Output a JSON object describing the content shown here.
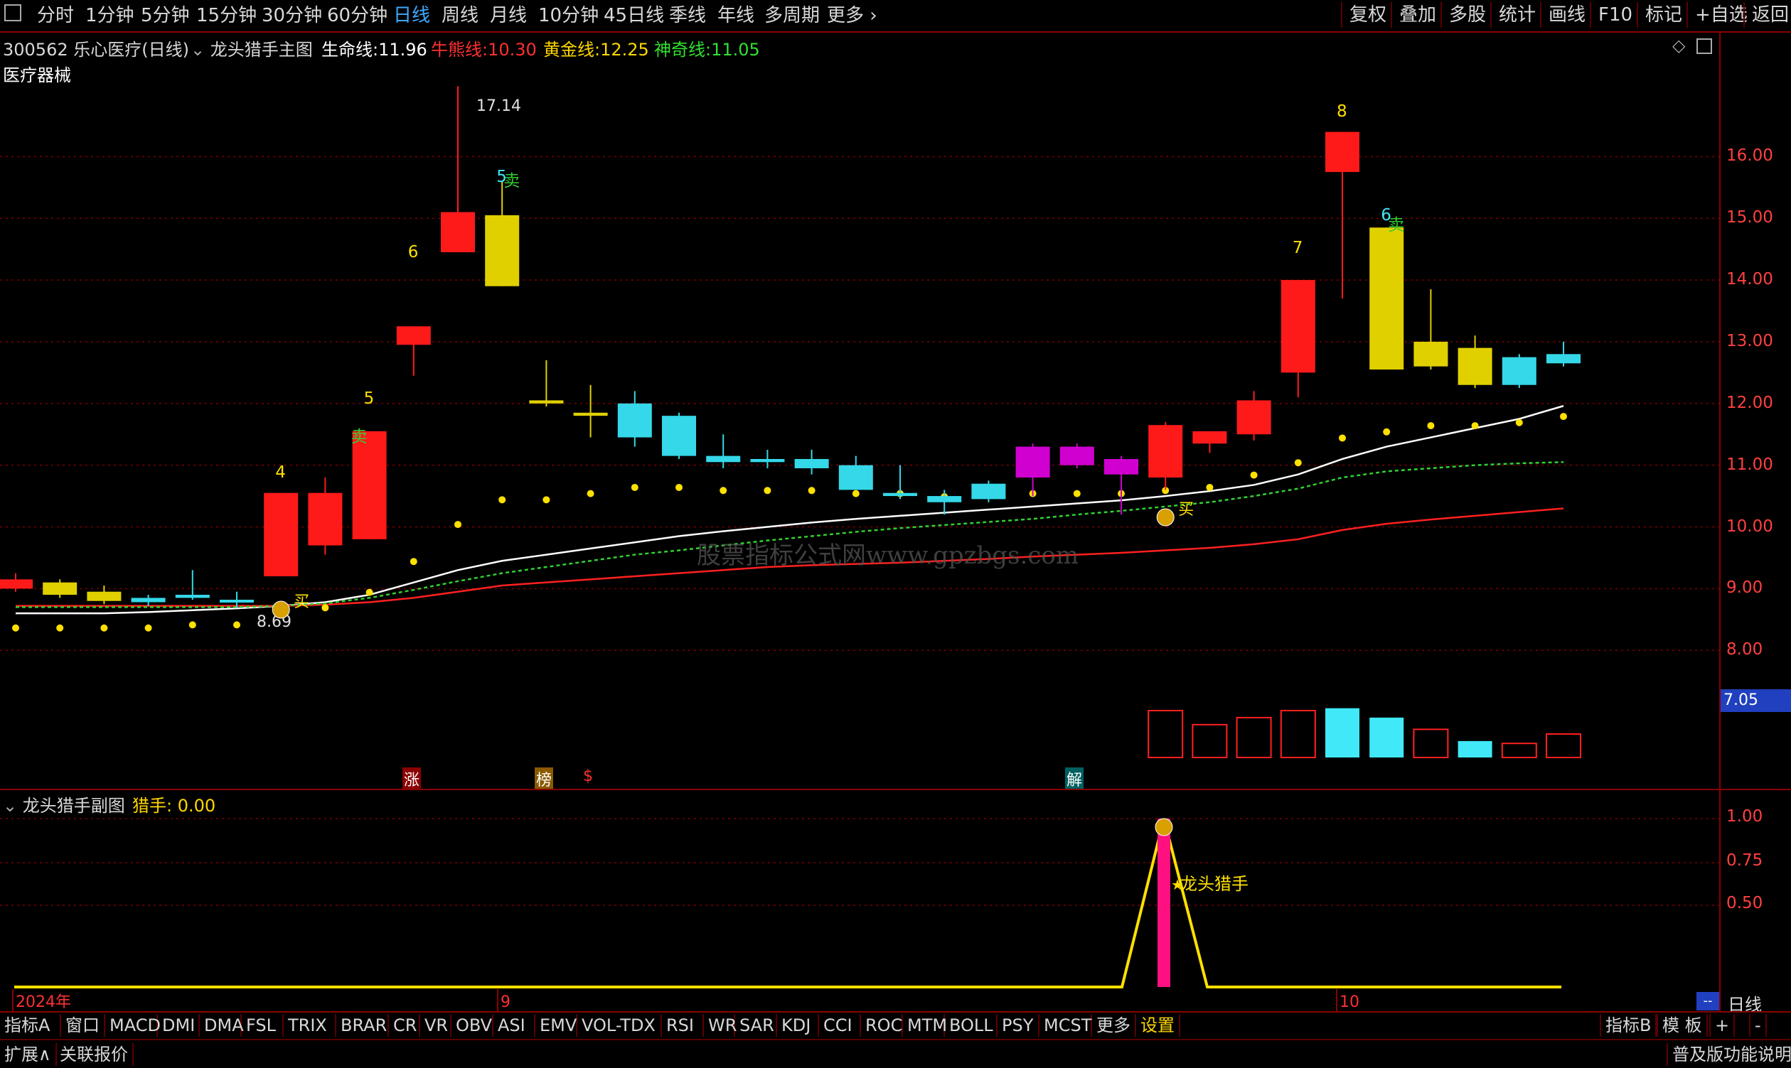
{
  "toolbar": {
    "left_icon": "window-icon",
    "periods": [
      "分时",
      "1分钟",
      "5分钟",
      "15分钟",
      "30分钟",
      "60分钟",
      "日线",
      "周线",
      "月线",
      "10分钟",
      "45日线",
      "季线",
      "年线",
      "多周期",
      "更多"
    ],
    "active_period": "日线",
    "right": [
      "复权",
      "叠加",
      "多股",
      "统计",
      "画线",
      "F10",
      "标记",
      "+自选",
      "返回"
    ]
  },
  "header": {
    "stock": "300562 乐心医疗(日线)",
    "indicator": "龙头猎手主图",
    "line1_label": "生命线:",
    "line1_value": "11.96",
    "line2_label": "牛熊线:",
    "line2_value": "10.30",
    "line3_label": "黄金线:",
    "line3_value": "12.25",
    "line4_label": "神奇线:",
    "line4_value": "11.05",
    "sector": "医疗器械"
  },
  "watermark": "股票指标公式网www.gpzbgs.com",
  "main_chart": {
    "y_ticks": [
      "16.00",
      "15.00",
      "14.00",
      "13.00",
      "12.00",
      "11.00",
      "10.00",
      "9.00",
      "8.00"
    ],
    "current_price": "7.05",
    "high_label": "17.14",
    "low_label": "8.69",
    "buy_label": "买",
    "sell_label": "卖",
    "count_labels": [
      "4",
      "5",
      "6",
      "5",
      "7",
      "8",
      "6"
    ],
    "event_tags": [
      "涨",
      "榜",
      "$",
      "解"
    ]
  },
  "chart_data": {
    "type": "candlestick",
    "title": "300562 乐心医疗(日线)",
    "ylim": [
      7.0,
      17.8
    ],
    "candles": [
      {
        "o": 9.15,
        "h": 9.25,
        "l": 8.95,
        "c": 9.0,
        "color": "red"
      },
      {
        "o": 9.1,
        "h": 9.15,
        "l": 8.85,
        "c": 8.9,
        "color": "yellow"
      },
      {
        "o": 8.95,
        "h": 9.05,
        "l": 8.75,
        "c": 8.8,
        "color": "yellow"
      },
      {
        "o": 8.85,
        "h": 8.9,
        "l": 8.72,
        "c": 8.78,
        "color": "cyan"
      },
      {
        "o": 8.9,
        "h": 9.3,
        "l": 8.82,
        "c": 8.85,
        "color": "cyan"
      },
      {
        "o": 8.82,
        "h": 8.95,
        "l": 8.69,
        "c": 8.78,
        "color": "cyan"
      },
      {
        "o": 9.2,
        "h": 10.55,
        "l": 9.2,
        "c": 10.55,
        "color": "red"
      },
      {
        "o": 9.7,
        "h": 10.8,
        "l": 9.55,
        "c": 10.55,
        "color": "red"
      },
      {
        "o": 9.8,
        "h": 11.55,
        "l": 9.8,
        "c": 11.55,
        "color": "red"
      },
      {
        "o": 13.25,
        "h": 13.25,
        "l": 12.45,
        "c": 12.95,
        "color": "red"
      },
      {
        "o": 14.45,
        "h": 17.14,
        "l": 14.45,
        "c": 15.1,
        "color": "red"
      },
      {
        "o": 13.9,
        "h": 15.6,
        "l": 13.9,
        "c": 15.05,
        "color": "yellow"
      },
      {
        "o": 12.05,
        "h": 12.7,
        "l": 11.95,
        "c": 12.0,
        "color": "yellow"
      },
      {
        "o": 11.85,
        "h": 12.3,
        "l": 11.45,
        "c": 11.8,
        "color": "yellow"
      },
      {
        "o": 11.45,
        "h": 12.2,
        "l": 11.3,
        "c": 12.0,
        "color": "cyan"
      },
      {
        "o": 11.15,
        "h": 11.85,
        "l": 11.1,
        "c": 11.8,
        "color": "cyan"
      },
      {
        "o": 11.05,
        "h": 11.5,
        "l": 10.95,
        "c": 11.15,
        "color": "cyan"
      },
      {
        "o": 11.05,
        "h": 11.25,
        "l": 10.95,
        "c": 11.1,
        "color": "cyan"
      },
      {
        "o": 10.95,
        "h": 11.25,
        "l": 10.85,
        "c": 11.1,
        "color": "cyan"
      },
      {
        "o": 10.6,
        "h": 11.15,
        "l": 10.6,
        "c": 11.0,
        "color": "cyan"
      },
      {
        "o": 10.5,
        "h": 11.0,
        "l": 10.45,
        "c": 10.55,
        "color": "cyan"
      },
      {
        "o": 10.4,
        "h": 10.6,
        "l": 10.2,
        "c": 10.5,
        "color": "cyan"
      },
      {
        "o": 10.45,
        "h": 10.75,
        "l": 10.4,
        "c": 10.7,
        "color": "cyan"
      },
      {
        "o": 10.8,
        "h": 11.35,
        "l": 10.5,
        "c": 11.3,
        "color": "magenta"
      },
      {
        "o": 11.0,
        "h": 11.35,
        "l": 10.95,
        "c": 11.3,
        "color": "magenta"
      },
      {
        "o": 10.85,
        "h": 11.15,
        "l": 10.2,
        "c": 11.1,
        "color": "magenta"
      },
      {
        "o": 10.8,
        "h": 11.7,
        "l": 10.6,
        "c": 11.65,
        "color": "red"
      },
      {
        "o": 11.35,
        "h": 11.55,
        "l": 11.2,
        "c": 11.55,
        "color": "red"
      },
      {
        "o": 11.5,
        "h": 12.2,
        "l": 11.4,
        "c": 12.05,
        "color": "red"
      },
      {
        "o": 12.5,
        "h": 13.45,
        "l": 12.1,
        "c": 14.0,
        "color": "red"
      },
      {
        "o": 15.75,
        "h": 15.75,
        "l": 13.7,
        "c": 16.4,
        "color": "red"
      },
      {
        "o": 14.85,
        "h": 14.85,
        "l": 12.55,
        "c": 12.55,
        "color": "yellow"
      },
      {
        "o": 13.0,
        "h": 13.85,
        "l": 12.55,
        "c": 12.6,
        "color": "yellow"
      },
      {
        "o": 12.9,
        "h": 13.1,
        "l": 12.25,
        "c": 12.3,
        "color": "yellow"
      },
      {
        "o": 12.75,
        "h": 12.8,
        "l": 12.25,
        "c": 12.3,
        "color": "cyan"
      },
      {
        "o": 12.8,
        "h": 13.0,
        "l": 12.6,
        "c": 12.65,
        "color": "cyan"
      }
    ],
    "series": [
      {
        "name": "生命线",
        "values": [
          8.6,
          8.6,
          8.6,
          8.62,
          8.65,
          8.68,
          8.72,
          8.78,
          8.9,
          9.1,
          9.3,
          9.45,
          9.55,
          9.65,
          9.75,
          9.85,
          9.93,
          10.0,
          10.07,
          10.13,
          10.18,
          10.23,
          10.28,
          10.33,
          10.38,
          10.43,
          10.5,
          10.58,
          10.68,
          10.85,
          11.1,
          11.3,
          11.45,
          11.6,
          11.75,
          11.96
        ]
      },
      {
        "name": "牛熊线",
        "values": [
          8.72,
          8.72,
          8.72,
          8.72,
          8.72,
          8.72,
          8.72,
          8.74,
          8.78,
          8.85,
          8.95,
          9.05,
          9.1,
          9.15,
          9.2,
          9.25,
          9.3,
          9.35,
          9.38,
          9.4,
          9.42,
          9.45,
          9.48,
          9.52,
          9.55,
          9.58,
          9.62,
          9.66,
          9.72,
          9.8,
          9.95,
          10.05,
          10.12,
          10.18,
          10.24,
          10.3
        ]
      },
      {
        "name": "神奇线",
        "values": [
          8.7,
          8.7,
          8.7,
          8.7,
          8.7,
          8.7,
          8.72,
          8.76,
          8.85,
          8.98,
          9.12,
          9.25,
          9.35,
          9.45,
          9.55,
          9.62,
          9.7,
          9.78,
          9.85,
          9.92,
          9.98,
          10.03,
          10.08,
          10.13,
          10.2,
          10.26,
          10.33,
          10.4,
          10.5,
          10.62,
          10.8,
          10.9,
          10.95,
          11.0,
          11.03,
          11.05
        ]
      },
      {
        "name": "黄金线",
        "values": [
          8.8,
          8.8,
          8.8,
          8.8,
          8.85,
          8.85,
          9.2,
          9.15,
          9.4,
          9.9,
          10.5,
          10.9,
          10.9,
          11.0,
          11.1,
          11.1,
          11.05,
          11.05,
          11.05,
          11.0,
          11.0,
          10.95,
          11.0,
          11.0,
          11.0,
          11.0,
          11.05,
          11.1,
          11.3,
          11.5,
          11.9,
          12.0,
          12.1,
          12.1,
          12.15,
          12.25
        ]
      }
    ],
    "volume": [
      1.0,
      0.7,
      0.85,
      1.0,
      1.05,
      0.85,
      0.6,
      0.35,
      0.3,
      0.5
    ],
    "volume_colors": [
      "red",
      "red",
      "red",
      "red",
      "cyan",
      "cyan",
      "red",
      "cyan",
      "red",
      "red"
    ]
  },
  "sub_chart": {
    "title": "龙头猎手副图",
    "value_label": "猎手:",
    "value": "0.00",
    "y_ticks": [
      "1.00",
      "0.75",
      "0.50"
    ],
    "signal_label": "龙头猎手",
    "x_labels": [
      "2024年",
      "9",
      "10"
    ],
    "period_box": "日线"
  },
  "bottom_tabs": [
    "指标A",
    "窗口",
    "MACD",
    "DMI",
    "DMA",
    "FSL",
    "TRIX",
    "BRAR",
    "CR",
    "VR",
    "OBV",
    "ASI",
    "EMV",
    "VOL-TDX",
    "RSI",
    "WR",
    "SAR",
    "KDJ",
    "CCI",
    "ROC",
    "MTM",
    "BOLL",
    "PSY",
    "MCST",
    "更多",
    "设置"
  ],
  "bottom_right": [
    "指标B",
    "模 板",
    "+",
    "-"
  ],
  "status": {
    "expand": "扩展∧",
    "linked": "关联报价",
    "edition": "普及版功能说明"
  },
  "colors": {
    "up": "#ff2020",
    "down": "#40e0e8",
    "yellow": "#e8d400",
    "magenta": "#e020e0",
    "axis": "#8b0000"
  }
}
